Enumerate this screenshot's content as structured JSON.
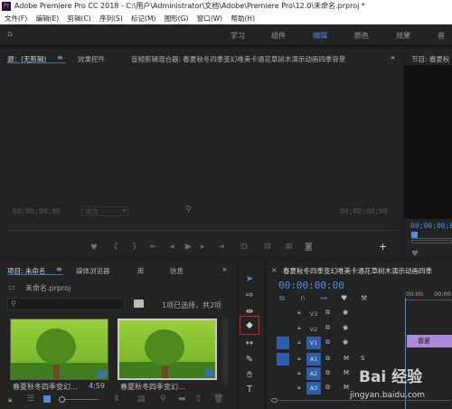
{
  "window": {
    "title": "Adobe Premiere Pro CC 2018 - C:\\用户\\Administrator\\文档\\Adobe\\Premiere Pro\\12.0\\未命名.prproj *",
    "app_icon_text": "Pr"
  },
  "menu": [
    "文件(F)",
    "编辑(E)",
    "剪辑(C)",
    "序列(S)",
    "标记(M)",
    "图形(G)",
    "窗口(W)",
    "帮助(H)"
  ],
  "workspaces": [
    "学习",
    "组件",
    "编辑",
    "颜色",
    "效果",
    "音"
  ],
  "source_panel": {
    "tab_source": "源：(无剪辑)",
    "tab_effects": "效果控件",
    "tab_mixer": "音频剪辑混合器: 春夏秋冬四季变幻唯美卡通花草树木演示动画四季背景",
    "timecode": "00;00;00;00",
    "zoom": "适合"
  },
  "program_panel": {
    "title": "节目: 春夏秋",
    "timecode": "00;00;00;00"
  },
  "project_panel": {
    "tab_project": "项目: 未命名",
    "tab_media": "媒体浏览器",
    "tab_library": "库",
    "tab_info": "信息",
    "file": "未命名.prproj",
    "selection": "1项已选择，共2项",
    "search_placeholder": "",
    "thumbs": [
      {
        "caption": "春夏秋冬四季变幻...",
        "duration": "4;59"
      },
      {
        "caption": "春夏秋冬四季变幻..."
      }
    ]
  },
  "timeline": {
    "tab": "春夏秋冬四季变幻唯美卡通花草树木演示动画四季",
    "timecode": "00:00:00:00",
    "ruler": [
      ":00:00",
      "00:00"
    ],
    "video_tracks": [
      "V3",
      "V2",
      "V1"
    ],
    "audio_tracks": [
      "A1",
      "A2",
      "A3"
    ],
    "clip_label": "春夏"
  },
  "watermark": {
    "text": "Bai 经验",
    "url": "jingyan.baidu.com"
  },
  "colors": {
    "accent": "#4b8fe5",
    "highlight_box": "#d02020",
    "timeline_clip": "#a98ad8"
  }
}
